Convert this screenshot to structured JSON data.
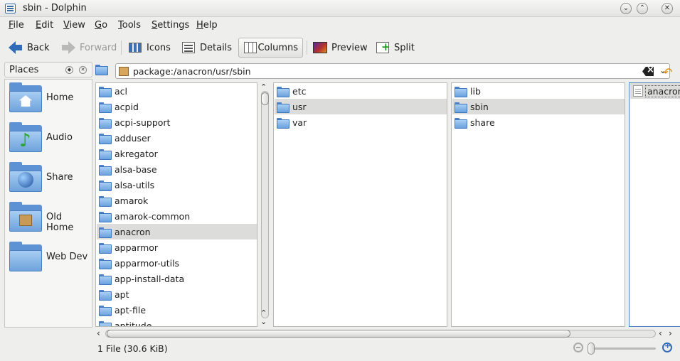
{
  "window": {
    "title": "sbin - Dolphin",
    "app_icon": "dolphin-file-manager-icon",
    "controls": [
      "minimize-icon",
      "maximize-icon",
      "close-icon"
    ]
  },
  "menu": [
    {
      "label": "File",
      "mnemonic": "F",
      "rest": "ile"
    },
    {
      "label": "Edit",
      "mnemonic": "E",
      "rest": "dit"
    },
    {
      "label": "View",
      "mnemonic": "V",
      "rest": "iew"
    },
    {
      "label": "Go",
      "mnemonic": "G",
      "rest": "o"
    },
    {
      "label": "Tools",
      "mnemonic": "T",
      "rest": "ools"
    },
    {
      "label": "Settings",
      "mnemonic": "S",
      "rest": "ettings"
    },
    {
      "label": "Help",
      "mnemonic": "H",
      "rest": "elp"
    }
  ],
  "toolbar": {
    "back": "Back",
    "forward": "Forward",
    "icons": "Icons",
    "details": "Details",
    "columns": "Columns",
    "preview": "Preview",
    "split": "Split",
    "active_view": "Columns"
  },
  "places": {
    "title": "Places",
    "items": [
      {
        "label": "Home",
        "icon": "home-folder-icon"
      },
      {
        "label": "Audio",
        "icon": "music-folder-icon"
      },
      {
        "label": "Share",
        "icon": "network-folder-icon"
      },
      {
        "label": "Old Home",
        "icon": "archive-folder-icon"
      },
      {
        "label": "Web Dev",
        "icon": "folder-icon"
      }
    ]
  },
  "location": {
    "path": "package:/anacron/usr/sbin"
  },
  "columns": [
    {
      "items": [
        "acl",
        "acpid",
        "acpi-support",
        "adduser",
        "akregator",
        "alsa-base",
        "alsa-utils",
        "amarok",
        "amarok-common",
        "anacron",
        "apparmor",
        "apparmor-utils",
        "app-install-data",
        "apt",
        "apt-file",
        "aptitude"
      ],
      "selected": "anacron"
    },
    {
      "items": [
        "etc",
        "usr",
        "var"
      ],
      "selected": "usr"
    },
    {
      "items": [
        "lib",
        "sbin",
        "share"
      ],
      "selected": "sbin"
    },
    {
      "items": [
        "anacron"
      ],
      "selected": "anacron",
      "item_type": "file"
    }
  ],
  "status": {
    "text": "1 File (30.6 KiB)"
  },
  "colors": {
    "accent": "#2f6bb8",
    "selection": "#dcdcda",
    "folder": "#6aa2de"
  }
}
